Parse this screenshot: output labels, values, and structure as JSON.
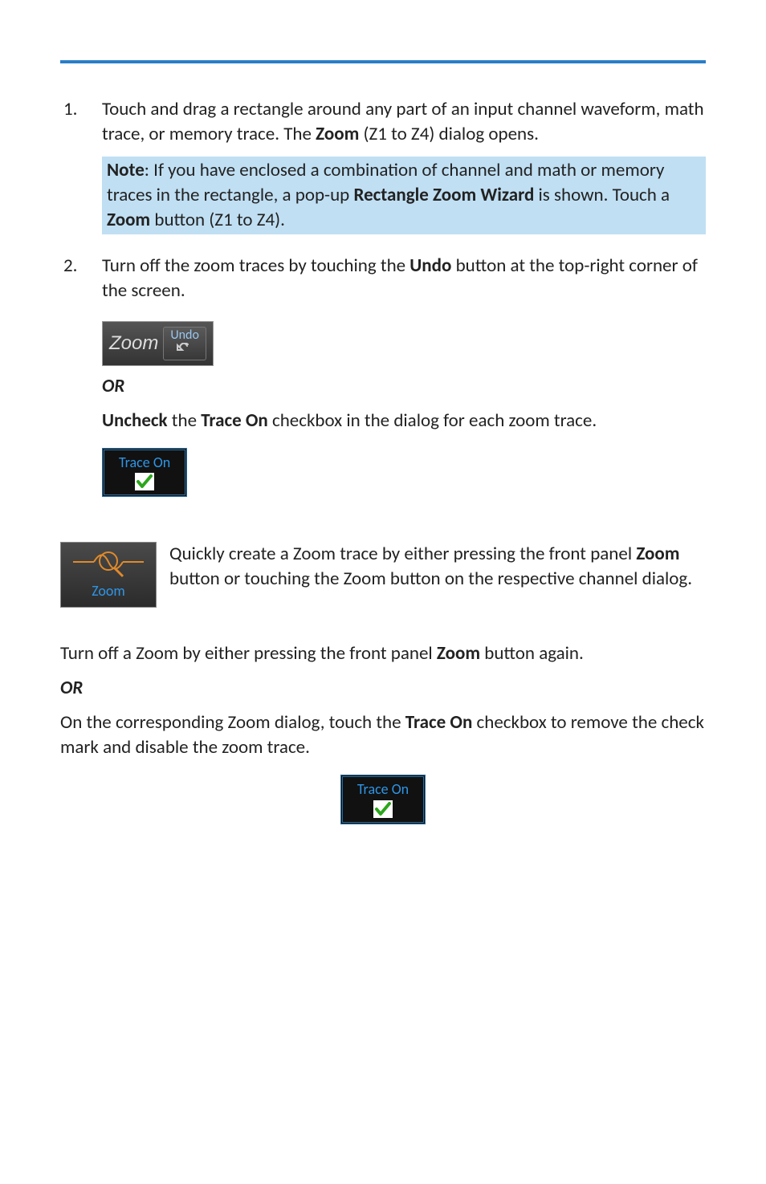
{
  "step1": {
    "num": "1.",
    "p1a": "Touch and drag a rectangle around any part of an input channel waveform, math trace, or memory trace. The ",
    "zoom": "Zoom",
    "p1b": " (Z1 to Z4) dialog opens."
  },
  "note": {
    "label": "Note",
    "a": ": If you have enclosed a combination of channel and math or memory traces in the rectangle, a pop-up ",
    "rzw": "Rectangle Zoom Wizard",
    "b": " is shown. Touch a ",
    "zoom": "Zoom",
    "c": " button (Z1 to Z4)."
  },
  "step2": {
    "num": "2.",
    "a": "Turn off the zoom traces by touching the ",
    "undo": "Undo",
    "b": " button at the top-right corner of the screen."
  },
  "zoomUndo": {
    "zoom": "Zoom",
    "undo": "Undo"
  },
  "step2_or": "OR",
  "step2_uncheck": {
    "uncheck": "Uncheck",
    "mid": " the ",
    "traceOn": "Trace On",
    "rest": " checkbox in the dialog for each zoom trace."
  },
  "traceOnLabel": "Trace On",
  "zoomRow": {
    "a": "Quickly create a Zoom trace by either pressing the front panel ",
    "zoom": "Zoom",
    "b": " button or touching the Zoom button on the respective channel dialog."
  },
  "frontZoomLabel": "Zoom",
  "turnOff": {
    "a": "Turn off a Zoom by either pressing the front panel ",
    "zoom": "Zoom",
    "b": " button again."
  },
  "bottom_or": "OR",
  "onCorr": {
    "a": "On the corresponding Zoom dialog, touch the ",
    "traceOn": "Trace On",
    "b": " checkbox to remove the check mark and disable the zoom trace."
  }
}
